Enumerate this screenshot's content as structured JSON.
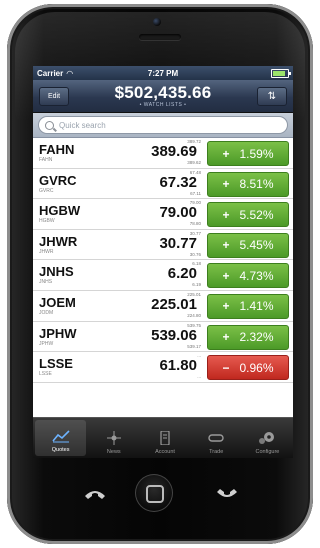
{
  "status": {
    "carrier": "Carrier",
    "time": "7:27 PM"
  },
  "nav": {
    "edit_label": "Edit",
    "total_value": "$502,435.66",
    "list_label": "WATCH LISTS"
  },
  "search": {
    "placeholder": "Quick search"
  },
  "stocks": [
    {
      "symbol": "FAHN",
      "sub": "FAHN",
      "price": "389.69",
      "high": "389.72",
      "low": "389.62",
      "change": "1.59%",
      "direction": "up"
    },
    {
      "symbol": "GVRC",
      "sub": "GVRC",
      "price": "67.32",
      "high": "67.48",
      "low": "67.11",
      "change": "8.51%",
      "direction": "up"
    },
    {
      "symbol": "HGBW",
      "sub": "HGBW",
      "price": "79.00",
      "high": "79.00",
      "low": "78.80",
      "change": "5.52%",
      "direction": "up"
    },
    {
      "symbol": "JHWR",
      "sub": "JHWR",
      "price": "30.77",
      "high": "30.77",
      "low": "30.76",
      "change": "5.45%",
      "direction": "up"
    },
    {
      "symbol": "JNHS",
      "sub": "JNHS",
      "price": "6.20",
      "high": "6.18",
      "low": "6.19",
      "change": "4.73%",
      "direction": "up"
    },
    {
      "symbol": "JOEM",
      "sub": "JODM",
      "price": "225.01",
      "high": "225.01",
      "low": "224.80",
      "change": "1.41%",
      "direction": "up"
    },
    {
      "symbol": "JPHW",
      "sub": "JPHW",
      "price": "539.06",
      "high": "539.75",
      "low": "539.17",
      "change": "2.32%",
      "direction": "up"
    },
    {
      "symbol": "LSSE",
      "sub": "LSSE",
      "price": "61.80",
      "high": "...",
      "low": "...",
      "change": "0.96%",
      "direction": "down"
    }
  ],
  "signs": {
    "up": "+",
    "down": "−"
  },
  "tabs": [
    {
      "label": "Quotes",
      "icon": "line-chart-icon",
      "active": true
    },
    {
      "label": "News",
      "icon": "news-icon",
      "active": false
    },
    {
      "label": "Account",
      "icon": "account-icon",
      "active": false
    },
    {
      "label": "Trade",
      "icon": "trade-icon",
      "active": false
    },
    {
      "label": "Configure",
      "icon": "gears-icon",
      "active": false
    }
  ],
  "colors": {
    "up": "#5aa932",
    "down": "#d0352b",
    "nav": "#2b3850"
  }
}
